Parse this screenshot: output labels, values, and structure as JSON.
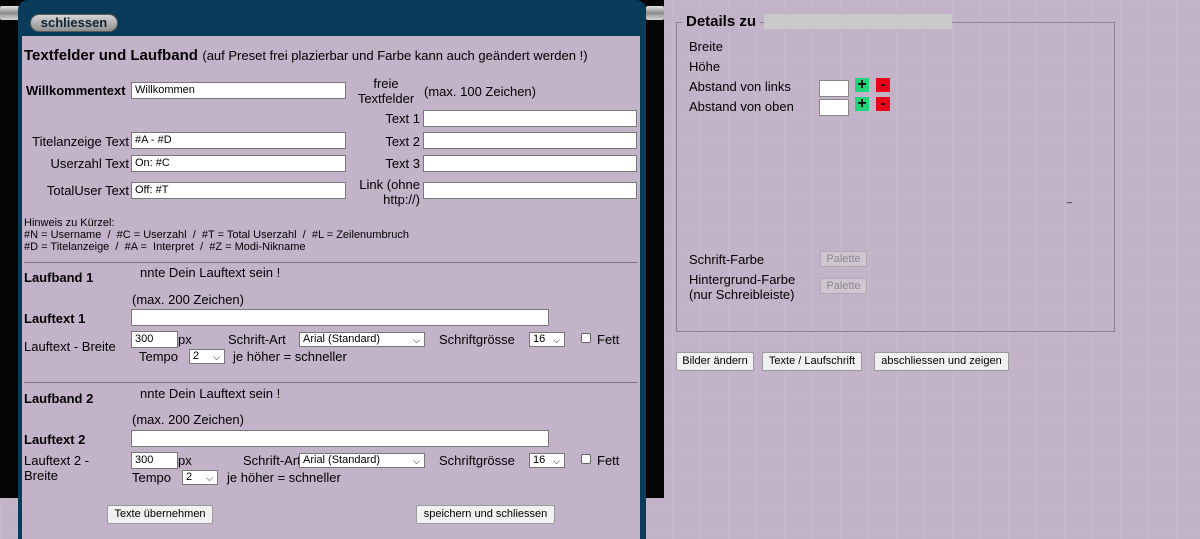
{
  "window": {
    "close_label": "schliessen",
    "title": "Textfelder und Laufband",
    "subtitle": "(auf Preset frei plazierbar und Farbe kann auch geändert werden !)"
  },
  "fields": {
    "welcome_label": "Willkommentext",
    "welcome_value": "Willkommen",
    "title_label": "Titelanzeige Text",
    "title_value": "#A - #D",
    "usercount_label": "Userzahl Text",
    "usercount_value": "On: #C",
    "totaluser_label": "TotalUser Text",
    "totaluser_value": "Off: #T"
  },
  "free_fields": {
    "label": "freie Textfelder",
    "note": "(max. 100 Zeichen)",
    "text1_label": "Text 1",
    "text1_value": "",
    "text2_label": "Text 2",
    "text2_value": "",
    "text3_label": "Text 3",
    "text3_value": "",
    "link_label": "Link (ohne http://)",
    "link_value": ""
  },
  "hint": {
    "line1": "Hinweis zu Kürzel:",
    "line2": "#N = Username  /  #C = Userzahl  /  #T = Total Userzahl  /  #L = Zeilenumbruch",
    "line3": "#D = Titelanzeige  /  #A =  Interpret  /  #Z = Modi-Nikname"
  },
  "laufband1": {
    "heading": "Laufband 1",
    "preview": "nnte Dein Lauftext sein !",
    "max_note": "(max. 200 Zeichen)",
    "text_label": "Lauftext 1",
    "text_value": "",
    "width_label": "Lauftext - Breite",
    "width_value": "300",
    "unit": "px",
    "font_label": "Schrift-Art",
    "font_value": "Arial (Standard)",
    "size_label": "Schriftgrösse",
    "size_value": "16",
    "bold_label": "Fett",
    "tempo_label": "Tempo",
    "tempo_value": "2",
    "tempo_note": "je höher = schneller"
  },
  "laufband2": {
    "heading": "Laufband 2",
    "preview": "nnte Dein Lauftext sein !",
    "max_note": "(max. 200 Zeichen)",
    "text_label": "Lauftext 2",
    "text_value": "",
    "width_label_1": "Lauftext 2 -",
    "width_label_2": "Breite",
    "width_value": "300",
    "unit": "px",
    "font_label": "Schrift-Art",
    "font_value": "Arial (Standard)",
    "size_label": "Schriftgrösse",
    "size_value": "16",
    "bold_label": "Fett",
    "tempo_label": "Tempo",
    "tempo_value": "2",
    "tempo_note": "je höher = schneller"
  },
  "buttons": {
    "apply": "Texte übernehmen",
    "save_close": "speichern und schliessen"
  },
  "details": {
    "title": "Details zu",
    "width_label": "Breite",
    "height_label": "Höhe",
    "left_label": "Abstand von links",
    "top_label": "Abstand von oben",
    "dash": "–",
    "font_color_label": "Schrift-Farbe",
    "bg_color_label_1": "Hintergrund-Farbe",
    "bg_color_label_2": "(nur Schreibleiste)",
    "palette_label": "Palette"
  },
  "actions": {
    "change_images": "Bilder ändern",
    "texts": "Texte / Laufschrift",
    "finish": "abschliessen und zeigen"
  },
  "colors": {
    "background": "#c3b3c9",
    "panel_border": "#083c5a",
    "plus": "#1fd47a",
    "minus": "#e8001b"
  }
}
